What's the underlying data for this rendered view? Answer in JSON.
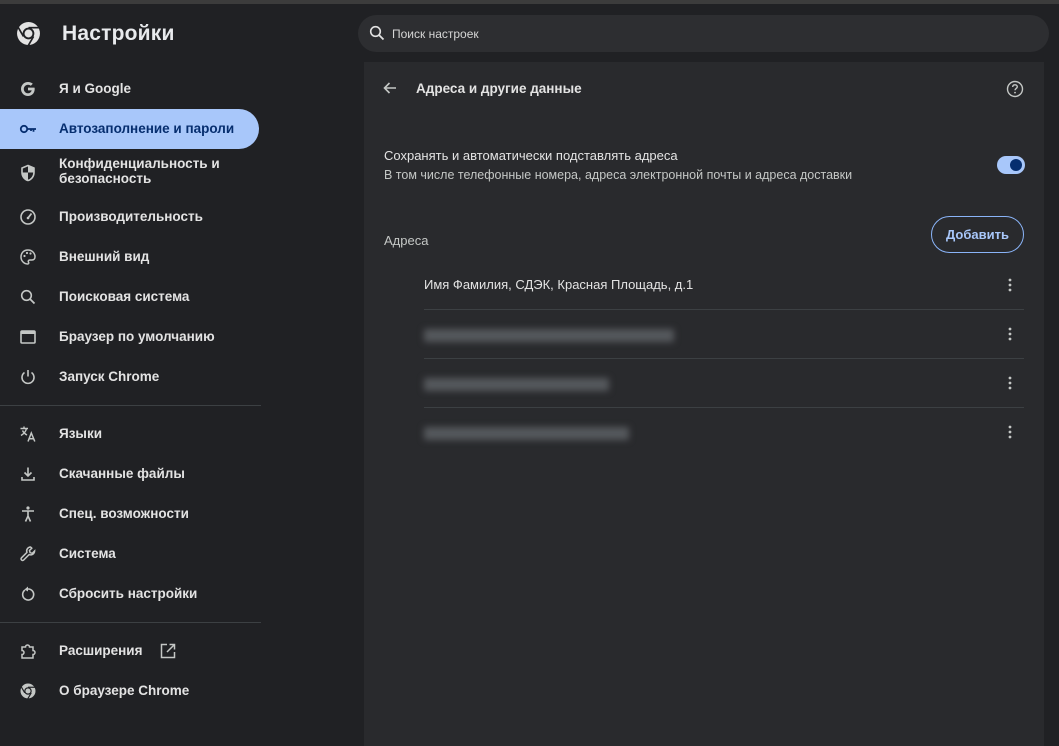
{
  "header": {
    "app_title": "Настройки",
    "search_placeholder": "Поиск настроек"
  },
  "sidebar": {
    "items": [
      {
        "label": "Я и Google",
        "icon": "google-icon"
      },
      {
        "label": "Автозаполнение и пароли",
        "icon": "key-icon",
        "active": true
      },
      {
        "label": "Конфиденциальность и безопасность",
        "icon": "shield-icon"
      },
      {
        "label": "Производительность",
        "icon": "speedometer-icon"
      },
      {
        "label": "Внешний вид",
        "icon": "palette-icon"
      },
      {
        "label": "Поисковая система",
        "icon": "search-icon"
      },
      {
        "label": "Браузер по умолчанию",
        "icon": "browser-window-icon"
      },
      {
        "label": "Запуск Chrome",
        "icon": "power-icon"
      },
      {
        "label": "Языки",
        "icon": "translate-icon"
      },
      {
        "label": "Скачанные файлы",
        "icon": "download-icon"
      },
      {
        "label": "Спец. возможности",
        "icon": "accessibility-icon"
      },
      {
        "label": "Система",
        "icon": "wrench-icon"
      },
      {
        "label": "Сбросить настройки",
        "icon": "reset-icon"
      },
      {
        "label": "Расширения",
        "icon": "puzzle-icon"
      },
      {
        "label": "О браузере Chrome",
        "icon": "chrome-icon"
      }
    ]
  },
  "main": {
    "title": "Адреса и другие данные",
    "save_toggle": {
      "title": "Сохранять и автоматически подставлять адреса",
      "subtitle": "В том числе телефонные номера, адреса электронной почты и адреса доставки",
      "enabled": true
    },
    "addresses_label": "Адреса",
    "add_button": "Добавить",
    "addresses": [
      {
        "text": "Имя Фамилия, СДЭК, Красная Площадь, д.1",
        "blurred": false
      },
      {
        "text": "",
        "blurred": true
      },
      {
        "text": "",
        "blurred": true
      },
      {
        "text": "",
        "blurred": true
      }
    ]
  },
  "colors": {
    "background": "#202124",
    "card": "#292a2d",
    "accent": "#a8c7fa",
    "accent_dark": "#062e6f"
  }
}
